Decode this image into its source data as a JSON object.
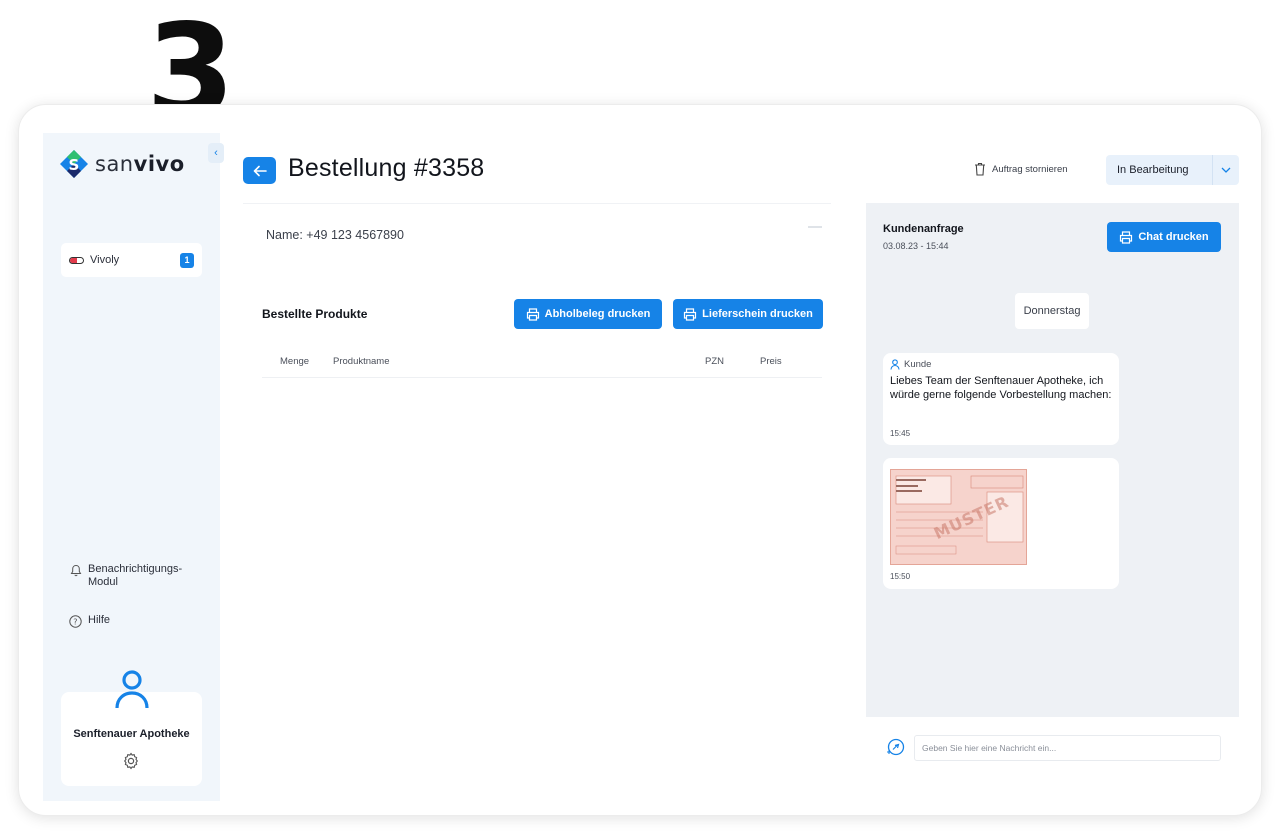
{
  "step_number": "3",
  "brand": {
    "name_light": "san",
    "name_bold": "vivo",
    "accent": "#1683e7"
  },
  "sidebar": {
    "items": [
      {
        "label": "Vivoly",
        "badge": "1",
        "icon": "pill-icon"
      }
    ],
    "links": [
      {
        "label": "Benachrichtigungs-\nModul",
        "icon": "bell-icon"
      },
      {
        "label": "Hilfe",
        "icon": "help-icon"
      }
    ],
    "profile": {
      "name": "Senftenauer Apotheke",
      "icon": "user-icon"
    }
  },
  "header": {
    "title": "Bestellung #3358",
    "cancel_label": "Auftrag stornieren",
    "status": "In Bearbeitung"
  },
  "order": {
    "name_line": "Name: +49 123 4567890",
    "section_title": "Bestellte Produkte",
    "pickup_button": "Abholbeleg drucken",
    "delivery_button": "Lieferschein drucken",
    "columns": [
      "Menge",
      "Produktname",
      "PZN",
      "Preis"
    ]
  },
  "chat": {
    "title": "Kundenanfrage",
    "timestamp": "03.08.23 - 15:44",
    "print_button": "Chat drucken",
    "day": "Donnerstag",
    "messages": [
      {
        "sender": "Kunde",
        "text": "Liebes Team der Senftenauer Apotheke, ich würde gerne folgende Vorbestellung machen:",
        "time": "15:45"
      },
      {
        "attachment": "prescription-image",
        "watermark": "MUSTER",
        "time": "15:50"
      }
    ],
    "input_placeholder": "Geben Sie hier eine Nachricht ein..."
  }
}
